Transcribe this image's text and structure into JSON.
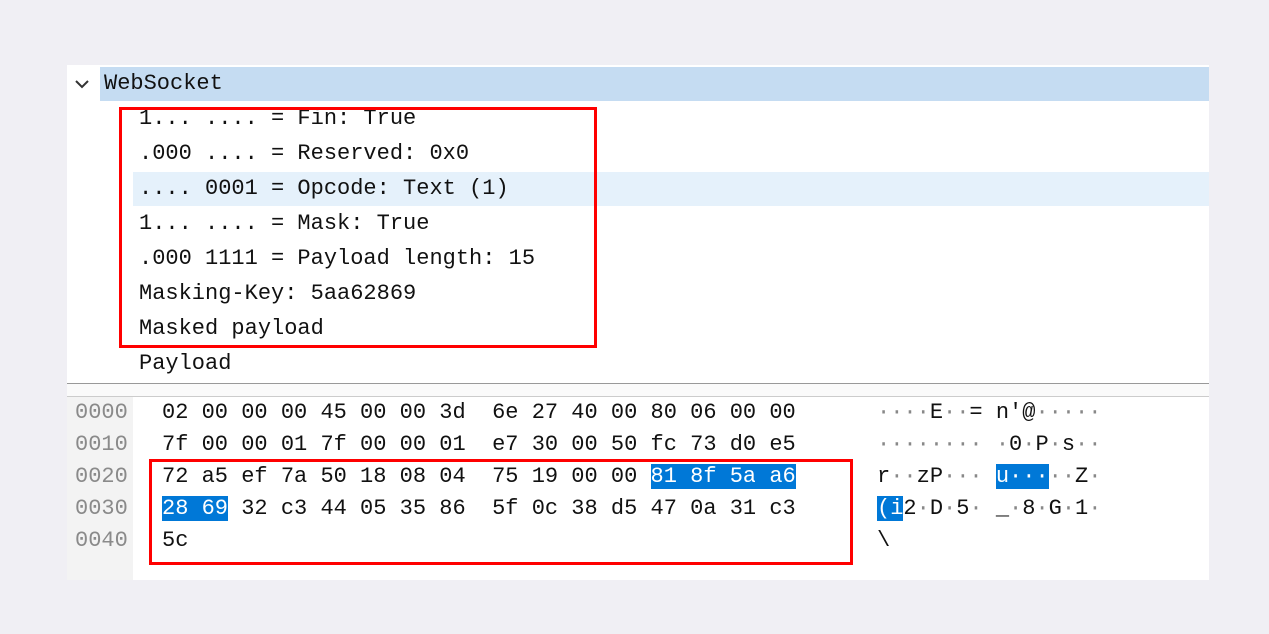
{
  "tree": {
    "header_label": "WebSocket",
    "header_icon": "chevron-down-icon",
    "rows": [
      {
        "text": "1... .... = Fin: True"
      },
      {
        "text": ".000 .... = Reserved: 0x0"
      },
      {
        "text": ".... 0001 = Opcode: Text (1)",
        "selected": true
      },
      {
        "text": "1... .... = Mask: True"
      },
      {
        "text": ".000 1111 = Payload length: 15"
      },
      {
        "text": "Masking-Key: 5aa62869"
      },
      {
        "text": "Masked payload"
      },
      {
        "text": "Payload"
      }
    ]
  },
  "hex": {
    "rows": [
      {
        "offset": "0000",
        "bytes": [
          "02",
          "00",
          "00",
          "00",
          "45",
          "00",
          "00",
          "3d",
          "6e",
          "27",
          "40",
          "00",
          "80",
          "06",
          "00",
          "00"
        ],
        "ascii": "····E··= n'@·····"
      },
      {
        "offset": "0010",
        "bytes": [
          "7f",
          "00",
          "00",
          "01",
          "7f",
          "00",
          "00",
          "01",
          "e7",
          "30",
          "00",
          "50",
          "fc",
          "73",
          "d0",
          "e5"
        ],
        "ascii": "········ ·0·P·s··"
      },
      {
        "offset": "0020",
        "bytes": [
          "72",
          "a5",
          "ef",
          "7a",
          "50",
          "18",
          "08",
          "04",
          "75",
          "19",
          "00",
          "00",
          "81",
          "8f",
          "5a",
          "a6"
        ],
        "ascii": "r··zP··· u···##··Z·",
        "hl_bytes": [
          12,
          13,
          14,
          15
        ]
      },
      {
        "offset": "0030",
        "bytes": [
          "28",
          "69",
          "32",
          "c3",
          "44",
          "05",
          "35",
          "86",
          "5f",
          "0c",
          "38",
          "d5",
          "47",
          "0a",
          "31",
          "c3"
        ],
        "ascii": "(i2·D·5· _·8·G·1·",
        "hl_bytes": [
          0,
          1
        ]
      },
      {
        "offset": "0040",
        "bytes": [
          "5c"
        ],
        "ascii": "\\"
      }
    ],
    "ascii_highlight": {
      "2": [
        13,
        17
      ],
      "3": [
        0,
        2
      ]
    }
  },
  "colors": {
    "selection": "#0078d7",
    "header_bg": "#c5dcf2",
    "selected_row_bg": "#e5f1fb",
    "annotation": "#ff0000"
  }
}
